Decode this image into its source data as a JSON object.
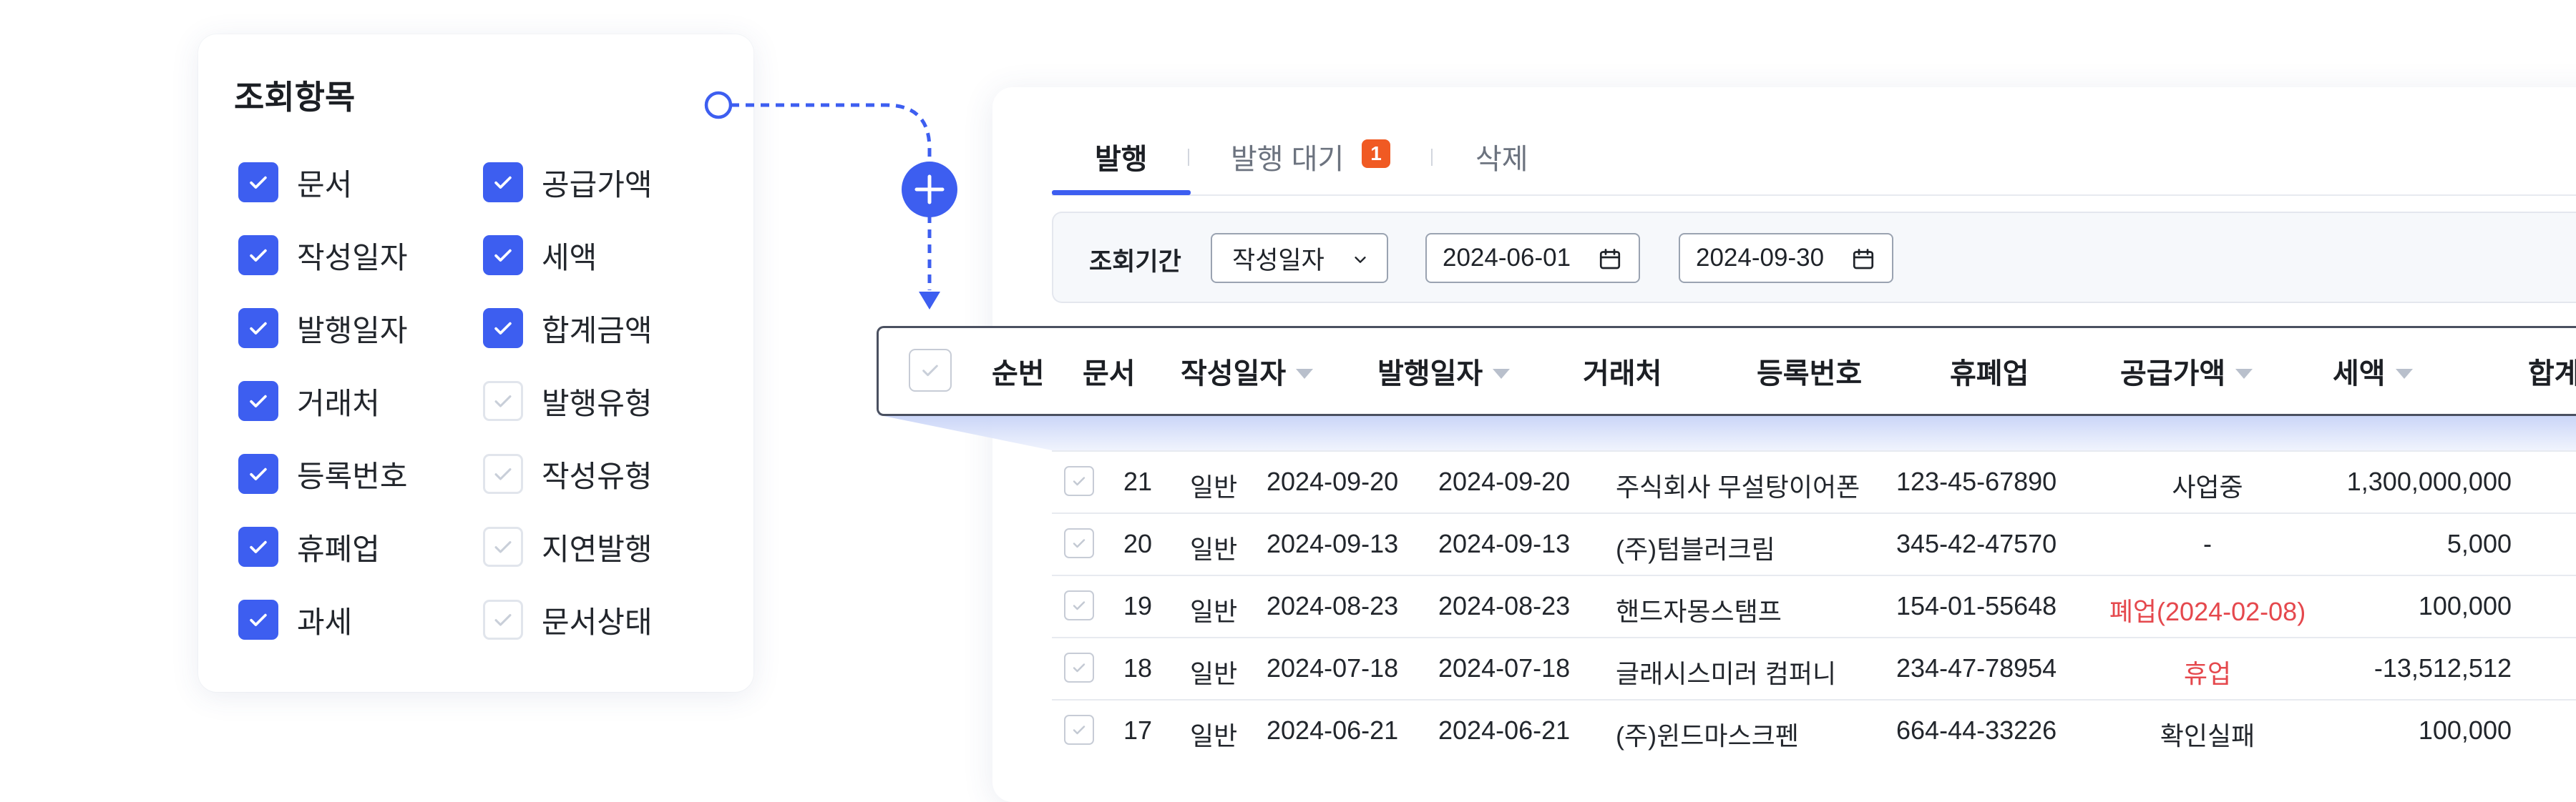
{
  "options_panel": {
    "title": "조회항목",
    "items": [
      {
        "label": "문서",
        "checked": true
      },
      {
        "label": "작성일자",
        "checked": true
      },
      {
        "label": "발행일자",
        "checked": true
      },
      {
        "label": "거래처",
        "checked": true
      },
      {
        "label": "등록번호",
        "checked": true
      },
      {
        "label": "휴폐업",
        "checked": true
      },
      {
        "label": "과세",
        "checked": true
      },
      {
        "label": "공급가액",
        "checked": true
      },
      {
        "label": "세액",
        "checked": true
      },
      {
        "label": "합계금액",
        "checked": true
      },
      {
        "label": "발행유형",
        "checked": false
      },
      {
        "label": "작성유형",
        "checked": false
      },
      {
        "label": "지연발행",
        "checked": false
      },
      {
        "label": "문서상태",
        "checked": false
      }
    ]
  },
  "tabs": [
    {
      "label": "발행",
      "active": true
    },
    {
      "label": "발행 대기",
      "active": false,
      "badge": "1"
    },
    {
      "label": "삭제",
      "active": false
    }
  ],
  "filter": {
    "label": "조회기간",
    "date_type": "작성일자",
    "start_date": "2024-06-01",
    "end_date": "2024-09-30"
  },
  "table": {
    "headers": [
      "순번",
      "문서",
      "작성일자",
      "발행일자",
      "거래처",
      "등록번호",
      "휴폐업",
      "공급가액",
      "세액",
      "합계"
    ],
    "rows": [
      {
        "no": "21",
        "doc": "일반",
        "written": "2024-09-20",
        "issued": "2024-09-20",
        "client": "주식회사 무설탕이어폰",
        "reg": "123-45-67890",
        "status": "사업중",
        "status_alert": false,
        "supply": "1,300,000,000"
      },
      {
        "no": "20",
        "doc": "일반",
        "written": "2024-09-13",
        "issued": "2024-09-13",
        "client": "(주)텀블러크림",
        "reg": "345-42-47570",
        "status": "-",
        "status_alert": false,
        "supply": "5,000"
      },
      {
        "no": "19",
        "doc": "일반",
        "written": "2024-08-23",
        "issued": "2024-08-23",
        "client": "핸드자몽스탬프",
        "reg": "154-01-55648",
        "status": "폐업(2024-02-08)",
        "status_alert": true,
        "supply": "100,000"
      },
      {
        "no": "18",
        "doc": "일반",
        "written": "2024-07-18",
        "issued": "2024-07-18",
        "client": "글래시스미러 컴퍼니",
        "reg": "234-47-78954",
        "status": "휴업",
        "status_alert": true,
        "supply": "-13,512,512"
      },
      {
        "no": "17",
        "doc": "일반",
        "written": "2024-06-21",
        "issued": "2024-06-21",
        "client": "(주)윈드마스크펜",
        "reg": "664-44-33226",
        "status": "확인실패",
        "status_alert": false,
        "supply": "100,000"
      }
    ]
  },
  "colors": {
    "accent": "#3d5ef0",
    "badge": "#f05a23",
    "alert": "#e5484d"
  },
  "icons": {
    "add": "plus-circle-icon",
    "calendar": "calendar-icon",
    "select": "chevron-down-icon",
    "sort": "sort-caret-icon",
    "check": "check-icon"
  }
}
